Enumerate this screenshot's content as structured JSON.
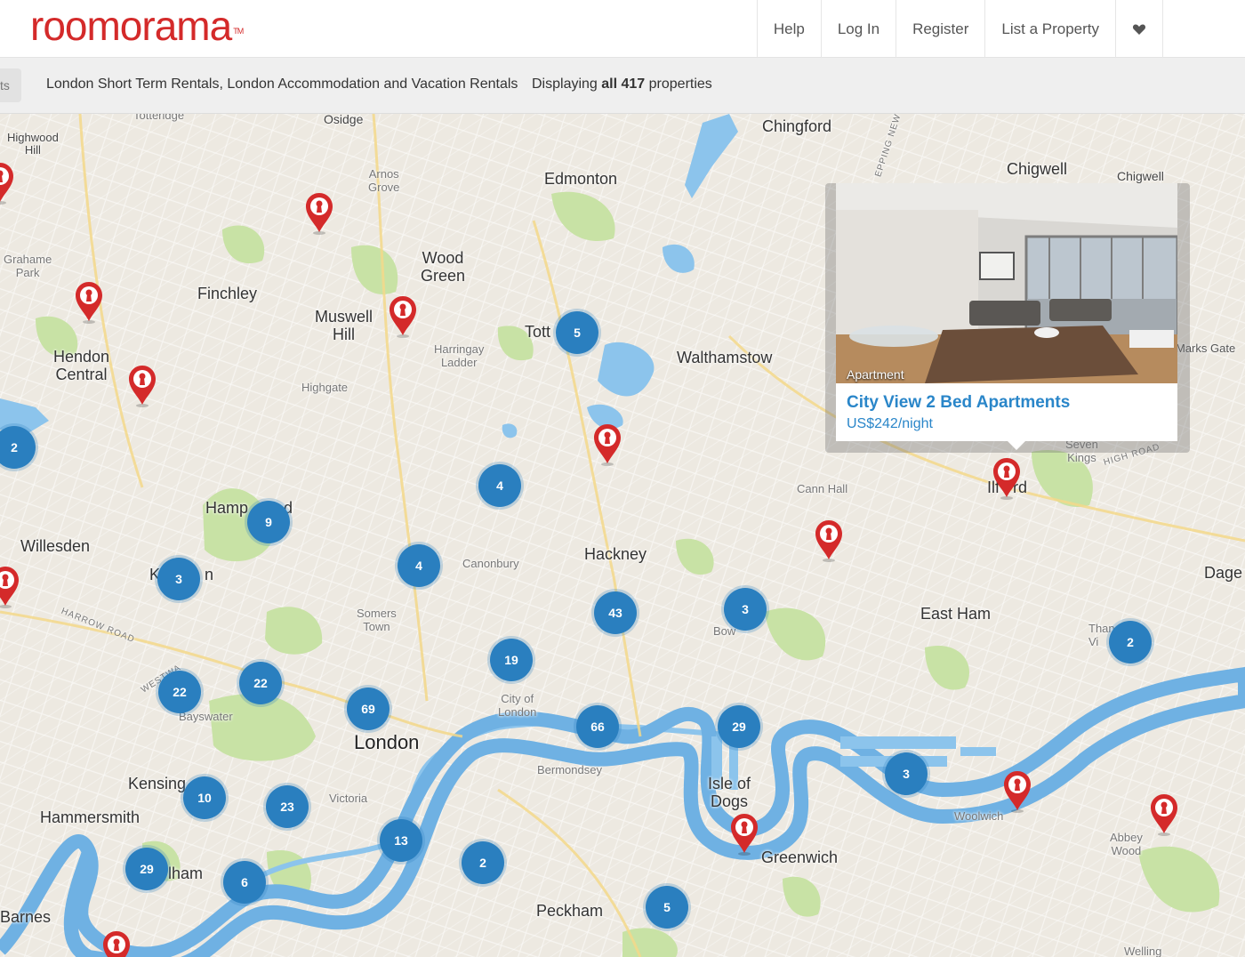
{
  "header": {
    "logo": "roomorama",
    "logo_tm": "TM",
    "nav": [
      "Help",
      "Log In",
      "Register",
      "List a Property"
    ]
  },
  "subbar": {
    "back_fragment": "ts",
    "title": "London Short Term Rentals, London Accommodation and Vacation Rentals",
    "displaying_prefix": "Displaying",
    "displaying_bold": "all 417",
    "displaying_suffix": "properties"
  },
  "map": {
    "places": {
      "tottenridge": "Totteridge",
      "osidge": "Osidge",
      "chingford": "Chingford",
      "highwood_hill": "Highwood\nHill",
      "edmonton": "Edmonton",
      "chigwell_big": "Chigwell",
      "chigwell_small": "Chigwell",
      "arnos_grove": "Arnos\nGrove",
      "grahame_park": "Grahame\nPark",
      "wood_green": "Wood\nGreen",
      "finchley": "Finchley",
      "muswell_hill": "Muswell\nHill",
      "tottenham": "Tott      m",
      "walthamstow": "Walthamstow",
      "hendon_central": "Hendon\nCentral",
      "harringay_ladder": "Harringay\nLadder",
      "highgate": "Highgate",
      "marks_gate": "Marks Gate",
      "seven_kings": "Seven\nKings",
      "cann_hall": "Cann Hall",
      "ilford": "Ilf   rd",
      "hampstead": "Hamp        d",
      "willesden": "Willesden",
      "kilburn": "K          n",
      "canonbury": "Canonbury",
      "hackney": "Hackney",
      "dagenham": "Dage",
      "east_ham": "East Ham",
      "somers_town": "Somers\nTown",
      "bow": "Bow",
      "thames_view": "Than\nVi",
      "bayswater": "Bayswater",
      "city_of_london": "City of\nLondon",
      "london": "London",
      "bermondsey": "Bermondsey",
      "isle_of_dogs": "Isle of\nDogs",
      "kensington": "Kensing",
      "victoria": "Victoria",
      "hammersmith": "Hammersmith",
      "woolwich": "Woolwich",
      "abbey_wood": "Abbey\nWood",
      "greenwich": "Greenwich",
      "fulham": "lham",
      "barnes": "Barnes",
      "peckham": "Peckham",
      "welling": "Welling",
      "harrow_road": "HARROW ROAD",
      "westway": "WESTWA",
      "epping_new": "EPPING NEW",
      "high_road": "HIGH ROAD"
    },
    "clusters": [
      "5",
      "2",
      "4",
      "9",
      "4",
      "3",
      "43",
      "3",
      "2",
      "19",
      "22",
      "22",
      "69",
      "66",
      "29",
      "3",
      "10",
      "23",
      "13",
      "2",
      "29",
      "6",
      "5"
    ],
    "pin_color": "#d42a2a",
    "cluster_color": "#2a7fbf",
    "water_color": "#8cc4ec",
    "park_color": "#c8e2a5"
  },
  "popup": {
    "type": "Apartment",
    "title": "City View 2 Bed Apartments",
    "price": "US$242/night"
  }
}
